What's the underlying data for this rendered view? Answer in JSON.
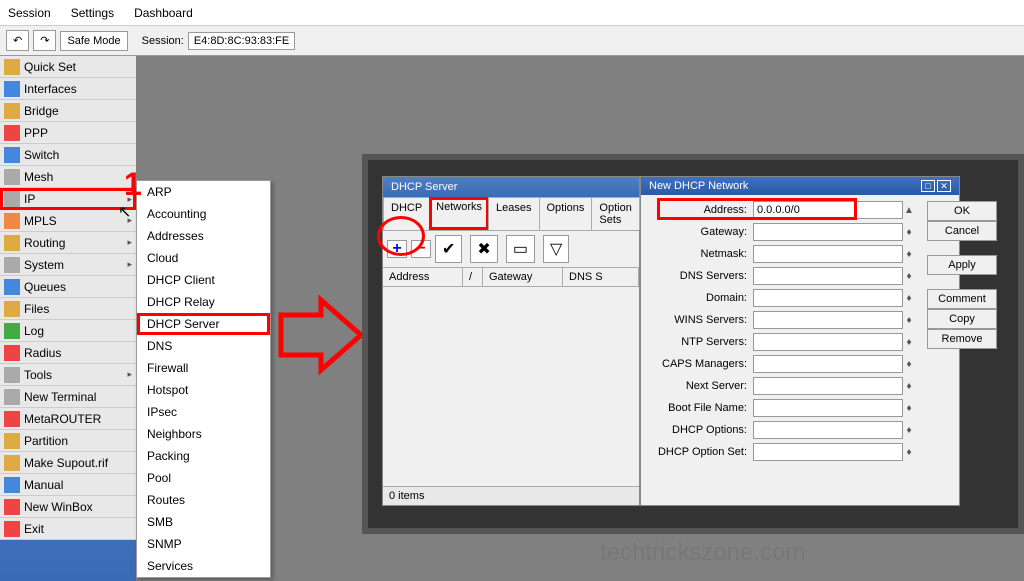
{
  "menubar": [
    "Session",
    "Settings",
    "Dashboard"
  ],
  "toolbar": {
    "safe_mode": "Safe Mode",
    "session_label": "Session:",
    "session_val": "E4:8D:8C:93:83:FE"
  },
  "sidebar": [
    "Quick Set",
    "Interfaces",
    "Bridge",
    "PPP",
    "Switch",
    "Mesh",
    "IP",
    "MPLS",
    "Routing",
    "System",
    "Queues",
    "Files",
    "Log",
    "Radius",
    "Tools",
    "New Terminal",
    "MetaROUTER",
    "Partition",
    "Make Supout.rif",
    "Manual",
    "New WinBox",
    "Exit"
  ],
  "sidebar_expandable": [
    "IP",
    "MPLS",
    "Routing",
    "System",
    "Tools"
  ],
  "sidebar_highlight": "IP",
  "submenu": [
    "ARP",
    "Accounting",
    "Addresses",
    "Cloud",
    "DHCP Client",
    "DHCP Relay",
    "DHCP Server",
    "DNS",
    "Firewall",
    "Hotspot",
    "IPsec",
    "Neighbors",
    "Packing",
    "Pool",
    "Routes",
    "SMB",
    "SNMP",
    "Services"
  ],
  "submenu_highlight": "DHCP Server",
  "annotation_1": "1",
  "dhcp_win": {
    "title": "DHCP Server",
    "tabs": [
      "DHCP",
      "Networks",
      "Leases",
      "Options",
      "Option Sets"
    ],
    "tab_highlight": "Networks",
    "columns": [
      "Address",
      "Gateway",
      "DNS S"
    ],
    "status": "0 items"
  },
  "new_net_win": {
    "title": "New DHCP Network",
    "fields": [
      {
        "label": "Address:",
        "value": "0.0.0.0/0",
        "hl": true
      },
      {
        "label": "Gateway:",
        "value": ""
      },
      {
        "label": "Netmask:",
        "value": ""
      },
      {
        "label": "DNS Servers:",
        "value": ""
      },
      {
        "label": "Domain:",
        "value": ""
      },
      {
        "label": "WINS Servers:",
        "value": ""
      },
      {
        "label": "NTP Servers:",
        "value": ""
      },
      {
        "label": "CAPS Managers:",
        "value": ""
      },
      {
        "label": "Next Server:",
        "value": ""
      },
      {
        "label": "Boot File Name:",
        "value": ""
      },
      {
        "label": "DHCP Options:",
        "value": ""
      },
      {
        "label": "DHCP Option Set:",
        "value": ""
      }
    ],
    "buttons": [
      "OK",
      "Cancel",
      "Apply",
      "Comment",
      "Copy",
      "Remove"
    ]
  },
  "watermark": "techtrickszone.com"
}
